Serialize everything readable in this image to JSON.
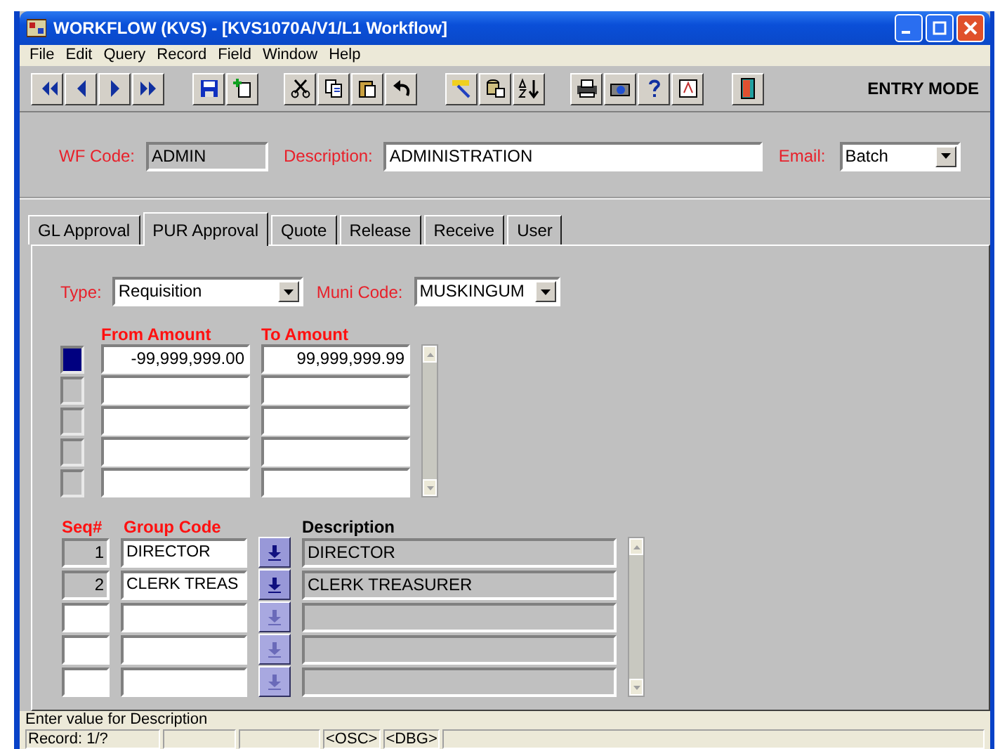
{
  "window": {
    "title": "WORKFLOW (KVS) - [KVS1070A/V1/L1 Workflow]"
  },
  "menu": [
    "File",
    "Edit",
    "Query",
    "Record",
    "Field",
    "Window",
    "Help"
  ],
  "toolbar": {
    "mode": "ENTRY MODE"
  },
  "header": {
    "wf_code": {
      "label": "WF Code:",
      "value": "ADMIN"
    },
    "description": {
      "label": "Description:",
      "value": "ADMINISTRATION"
    },
    "email": {
      "label": "Email:",
      "value": "Batch"
    }
  },
  "tabs": [
    {
      "label": "GL Approval",
      "selected": false
    },
    {
      "label": "PUR Approval",
      "selected": true
    },
    {
      "label": "Quote",
      "selected": false
    },
    {
      "label": "Release",
      "selected": false
    },
    {
      "label": "Receive",
      "selected": false
    },
    {
      "label": "User",
      "selected": false
    }
  ],
  "filters": {
    "type": {
      "label": "Type:",
      "value": "Requisition"
    },
    "muni_code": {
      "label": "Muni Code:",
      "value": "MUSKINGUM"
    }
  },
  "amounts": {
    "columns": [
      "From Amount",
      "To Amount"
    ],
    "rows": [
      {
        "from": "-99,999,999.00",
        "to": "99,999,999.99",
        "selected": true
      },
      {
        "selected": false
      },
      {
        "selected": false
      },
      {
        "selected": false
      },
      {
        "selected": false
      }
    ]
  },
  "groups": {
    "columns": [
      "Seq#",
      "Group Code",
      "Description"
    ],
    "rows": [
      {
        "seq": "1",
        "group_code": "DIRECTOR",
        "description": "DIRECTOR",
        "lookup_enabled": true
      },
      {
        "seq": "2",
        "group_code": "CLERK TREAS",
        "description": "CLERK TREASURER",
        "lookup_enabled": true
      },
      {
        "lookup_enabled": false
      },
      {
        "lookup_enabled": false
      },
      {
        "lookup_enabled": false
      }
    ]
  },
  "status_bar": {
    "message": "Enter value for Description",
    "record": "Record: 1/?",
    "flags": [
      "<OSC>",
      "<DBG>"
    ]
  }
}
